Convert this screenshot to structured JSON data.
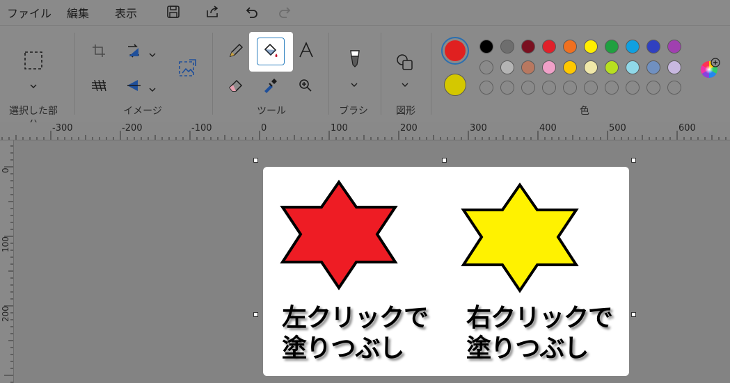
{
  "menu": {
    "file": "ファイル",
    "edit": "編集",
    "view": "表示"
  },
  "ribbon": {
    "groups": {
      "selection": "選択した部分",
      "image": "イメージ",
      "tools": "ツール",
      "brushes": "ブラシ",
      "shapes": "図形",
      "colors": "色"
    },
    "active_tool": "fill-bucket",
    "color1": "#e02020",
    "color2": "#d4c800"
  },
  "palette": {
    "row1": [
      "#000000",
      "#6e6e6e",
      "#7a1020",
      "#e0202a",
      "#f07020",
      "#ffee00",
      "#20a040",
      "#10a0e0",
      "#3040c0",
      "#a040b0"
    ],
    "row2": [
      "empty",
      "#b4b4b4",
      "#b87860",
      "#f0a0c8",
      "#ffc800",
      "#f0e8a8",
      "#b8e020",
      "#90d8e8",
      "#7090c0",
      "#c8b8e0"
    ],
    "row3": [
      "empty",
      "empty",
      "empty",
      "empty",
      "empty",
      "empty",
      "empty",
      "empty",
      "empty",
      "empty"
    ]
  },
  "ruler": {
    "top_labels": [
      "-300",
      "-200",
      "-100",
      "0",
      "100",
      "200",
      "300",
      "400",
      "500",
      "600"
    ],
    "left_labels": [
      "0",
      "100",
      "200"
    ]
  },
  "canvas": {
    "left_star_color": "#ee1c24",
    "right_star_color": "#fff200",
    "left_caption_line1": "左クリックで",
    "left_caption_line2": "塗りつぶし",
    "right_caption_line1": "右クリックで",
    "right_caption_line2": "塗りつぶし"
  }
}
